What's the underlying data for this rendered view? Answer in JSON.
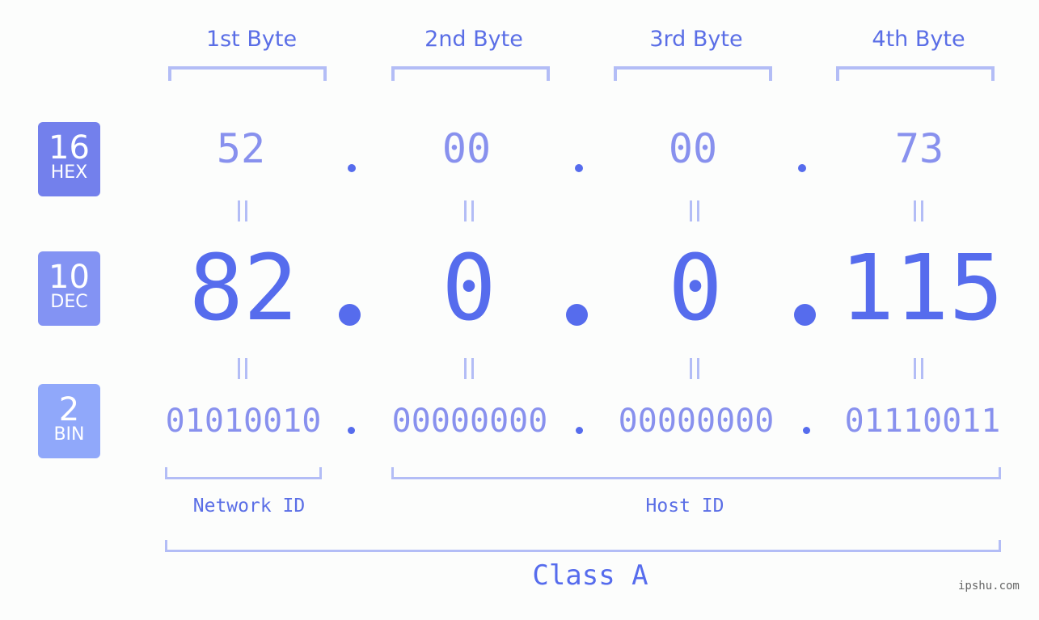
{
  "byte_headers": [
    "1st Byte",
    "2nd Byte",
    "3rd Byte",
    "4th Byte"
  ],
  "badges": [
    {
      "num": "16",
      "text": "HEX",
      "color": "#7380ec"
    },
    {
      "num": "10",
      "text": "DEC",
      "color": "#8393f3"
    },
    {
      "num": "2",
      "text": "BIN",
      "color": "#90a8fa"
    }
  ],
  "hex": [
    "52",
    "00",
    "00",
    "73"
  ],
  "dec": [
    "82",
    "0",
    "0",
    "115"
  ],
  "bin": [
    "01010010",
    "00000000",
    "00000000",
    "01110011"
  ],
  "network_id_label": "Network ID",
  "host_id_label": "Host ID",
  "class_label": "Class A",
  "watermark": "ipshu.com",
  "colors": {
    "accent": "#566ced",
    "light": "#8891ee",
    "bracket": "#b3bdf6"
  }
}
